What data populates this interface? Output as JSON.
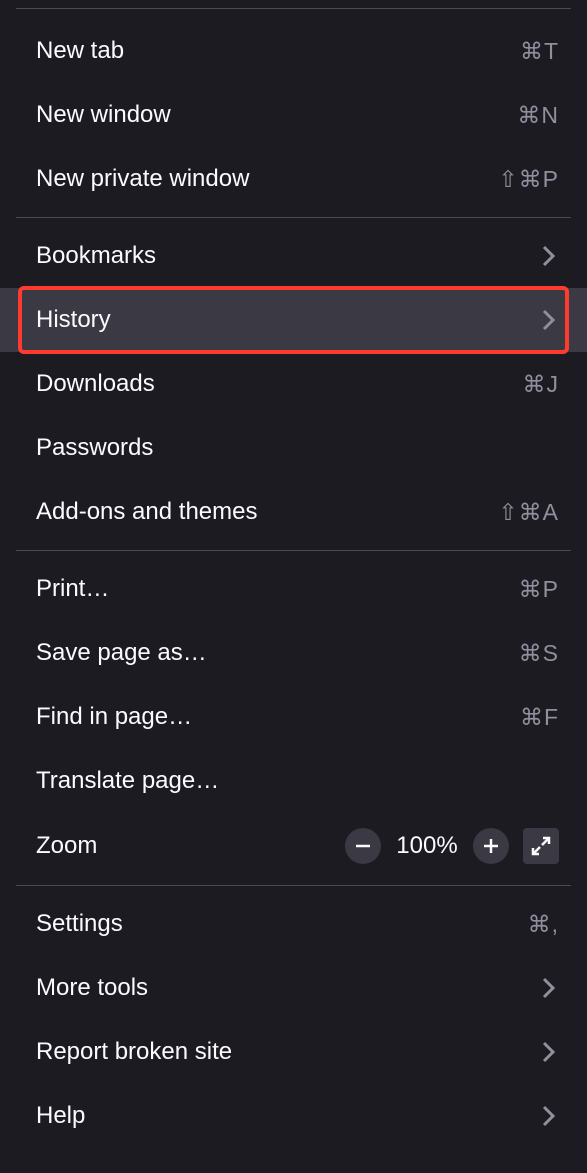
{
  "menu": {
    "section1": {
      "new_tab": {
        "label": "New tab",
        "shortcut": "⌘T"
      },
      "new_window": {
        "label": "New window",
        "shortcut": "⌘N"
      },
      "new_private_window": {
        "label": "New private window",
        "shortcut": "⇧⌘P"
      }
    },
    "section2": {
      "bookmarks": {
        "label": "Bookmarks"
      },
      "history": {
        "label": "History"
      },
      "downloads": {
        "label": "Downloads",
        "shortcut": "⌘J"
      },
      "passwords": {
        "label": "Passwords"
      },
      "addons": {
        "label": "Add-ons and themes",
        "shortcut": "⇧⌘A"
      }
    },
    "section3": {
      "print": {
        "label": "Print…",
        "shortcut": "⌘P"
      },
      "save_page": {
        "label": "Save page as…",
        "shortcut": "⌘S"
      },
      "find_in_page": {
        "label": "Find in page…",
        "shortcut": "⌘F"
      },
      "translate": {
        "label": "Translate page…"
      },
      "zoom": {
        "label": "Zoom",
        "value": "100%"
      }
    },
    "section4": {
      "settings": {
        "label": "Settings",
        "shortcut": "⌘,"
      },
      "more_tools": {
        "label": "More tools"
      },
      "report": {
        "label": "Report broken site"
      },
      "help": {
        "label": "Help"
      }
    }
  }
}
